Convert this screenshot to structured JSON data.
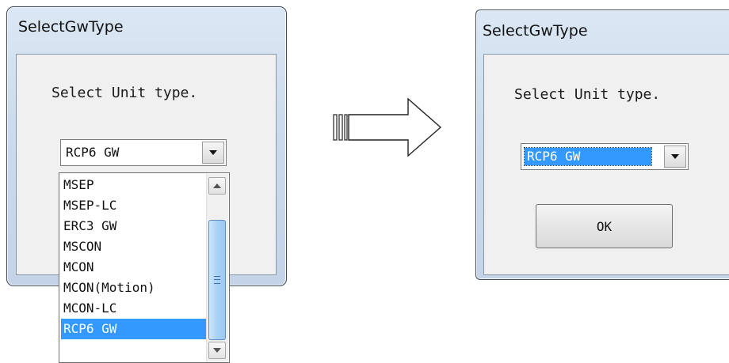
{
  "left_dialog": {
    "title": "SelectGwType",
    "prompt": "Select Unit type.",
    "combo_value": "RCP6 GW",
    "dropdown_items": [
      "MSEP",
      "MSEP-LC",
      "ERC3 GW",
      "MSCON",
      "MCON",
      "MCON(Motion)",
      "MCON-LC",
      "RCP6 GW"
    ],
    "selected_item": "RCP6 GW"
  },
  "right_dialog": {
    "title": "SelectGwType",
    "prompt": "Select Unit type.",
    "combo_value": "RCP6 GW",
    "ok_label": "OK"
  },
  "arrow": {
    "icon": "right-arrow-icon"
  },
  "colors": {
    "selection": "#3399ff",
    "frame": "#cddcec",
    "client": "#f0f0f0"
  }
}
